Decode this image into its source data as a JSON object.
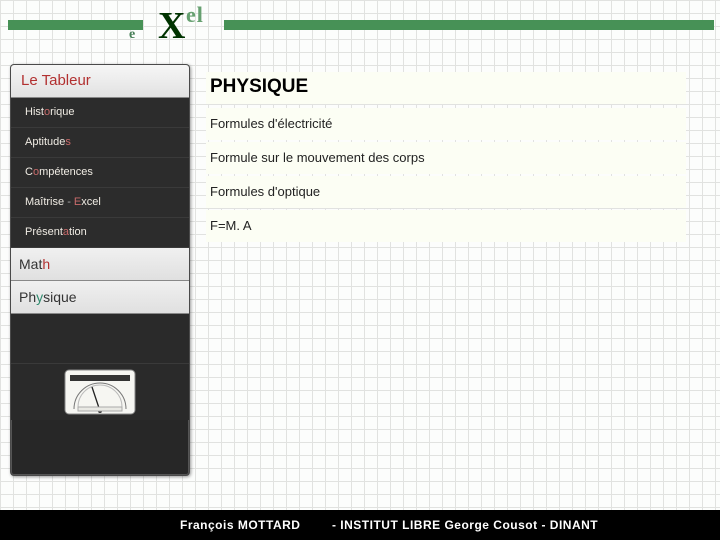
{
  "logo": {
    "big": "X",
    "left_e": "e",
    "el": "el"
  },
  "sidebar": {
    "title_pre": "Le  T",
    "title_hot": "a",
    "title_post": "bleur",
    "items": {
      "hist": {
        "pre": "Hist",
        "hot": "o",
        "post": "rique"
      },
      "apt": {
        "pre": "Aptitude",
        "hot": "s",
        "post": ""
      },
      "comp": {
        "pre": "C",
        "hot": "o",
        "post": "mpétences"
      },
      "mait": {
        "pre": "Maîtrise  ",
        "dash": "-",
        "hot2": "  E",
        "post": "xcel"
      },
      "pres": {
        "pre": "Présent",
        "hot": "a",
        "post": "tion"
      }
    },
    "sub1": {
      "pre": "Mat",
      "hot": "h"
    },
    "sub2": {
      "pre": "Ph",
      "hot": "y",
      "post": "sique"
    }
  },
  "content": {
    "title": "PHYSIQUE",
    "rows": {
      "r1": "Formules d'électricité",
      "r2": "Formule sur le mouvement des corps",
      "r3": "Formules d'optique",
      "r4": "F=M. A"
    }
  },
  "footer": {
    "author": "François MOTTARD",
    "inst": "- INSTITUT LIBRE George Cousot - DINANT"
  }
}
